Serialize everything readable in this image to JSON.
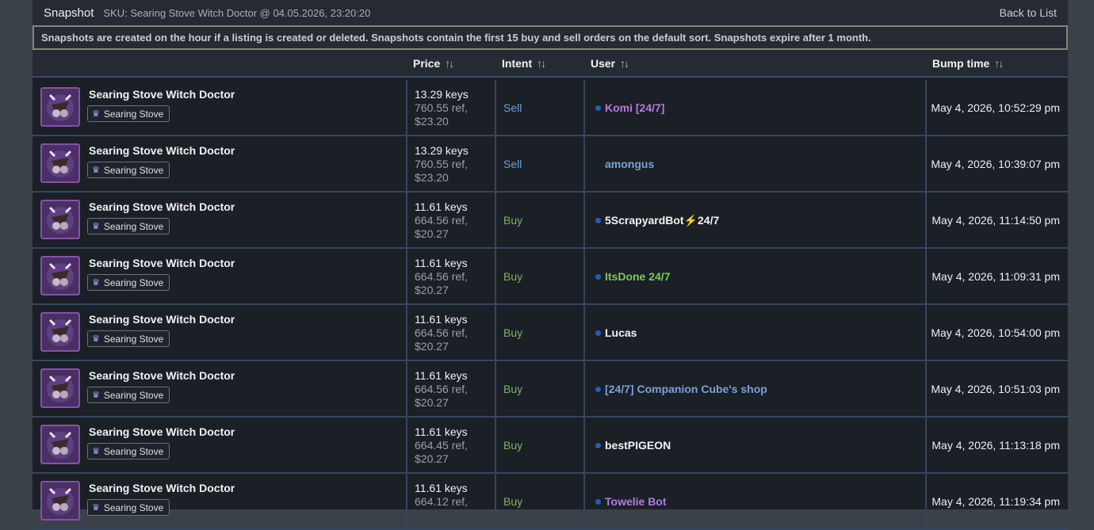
{
  "header": {
    "title": "Snapshot",
    "sku": "SKU: Searing Stove Witch Doctor @ 04.05.2026, 23:20:20",
    "back_link": "Back to List"
  },
  "notice": "Snapshots are created on the hour if a listing is created or deleted. Snapshots contain the first 15 buy and sell orders on the default sort. Snapshots expire after 1 month.",
  "columns": {
    "price": "Price",
    "intent": "Intent",
    "user": "User",
    "bump": "Bump time",
    "sort_icon": "sort-arrows-icon"
  },
  "colors": {
    "sell": "#6fa0d8",
    "buy": "#7bb661",
    "user_purple": "#b57be0",
    "user_green": "#7bc95e",
    "user_blue": "#7aa2d6",
    "user_white": "#f2f2f2",
    "icon_border": "#8650ac"
  },
  "rows": [
    {
      "item": "Searing Stove Witch Doctor",
      "effect": "Searing Stove",
      "keys": "13.29 keys",
      "ref": "760.55 ref,",
      "usd": "$23.20",
      "intent": "Sell",
      "user": "Komi [24/7]",
      "user_color": "purple",
      "dot": true,
      "bump": "May 4, 2026, 10:52:29 pm"
    },
    {
      "item": "Searing Stove Witch Doctor",
      "effect": "Searing Stove",
      "keys": "13.29 keys",
      "ref": "760.55 ref,",
      "usd": "$23.20",
      "intent": "Sell",
      "user": "amongus",
      "user_color": "blue",
      "dot": false,
      "bump": "May 4, 2026, 10:39:07 pm"
    },
    {
      "item": "Searing Stove Witch Doctor",
      "effect": "Searing Stove",
      "keys": "11.61 keys",
      "ref": "664.56 ref,",
      "usd": "$20.27",
      "intent": "Buy",
      "user": "5ScrapyardBot⚡24/7",
      "user_color": "white",
      "dot": true,
      "bump": "May 4, 2026, 11:14:50 pm"
    },
    {
      "item": "Searing Stove Witch Doctor",
      "effect": "Searing Stove",
      "keys": "11.61 keys",
      "ref": "664.56 ref,",
      "usd": "$20.27",
      "intent": "Buy",
      "user": "ItsDone 24/7",
      "user_color": "green",
      "dot": true,
      "bump": "May 4, 2026, 11:09:31 pm"
    },
    {
      "item": "Searing Stove Witch Doctor",
      "effect": "Searing Stove",
      "keys": "11.61 keys",
      "ref": "664.56 ref,",
      "usd": "$20.27",
      "intent": "Buy",
      "user": "Lucas",
      "user_color": "white",
      "dot": true,
      "bump": "May 4, 2026, 10:54:00 pm"
    },
    {
      "item": "Searing Stove Witch Doctor",
      "effect": "Searing Stove",
      "keys": "11.61 keys",
      "ref": "664.56 ref,",
      "usd": "$20.27",
      "intent": "Buy",
      "user": "[24/7] Companion Cube's shop",
      "user_color": "blue",
      "dot": true,
      "bump": "May 4, 2026, 10:51:03 pm"
    },
    {
      "item": "Searing Stove Witch Doctor",
      "effect": "Searing Stove",
      "keys": "11.61 keys",
      "ref": "664.45 ref,",
      "usd": "$20.27",
      "intent": "Buy",
      "user": "bestPIGEON",
      "user_color": "white",
      "dot": true,
      "bump": "May 4, 2026, 11:13:18 pm"
    },
    {
      "item": "Searing Stove Witch Doctor",
      "effect": "Searing Stove",
      "keys": "11.61 keys",
      "ref": "664.12 ref,",
      "usd": "",
      "intent": "Buy",
      "user": "Towelie Bot",
      "user_color": "purple",
      "dot": true,
      "bump": "May 4, 2026, 11:19:34 pm"
    }
  ]
}
